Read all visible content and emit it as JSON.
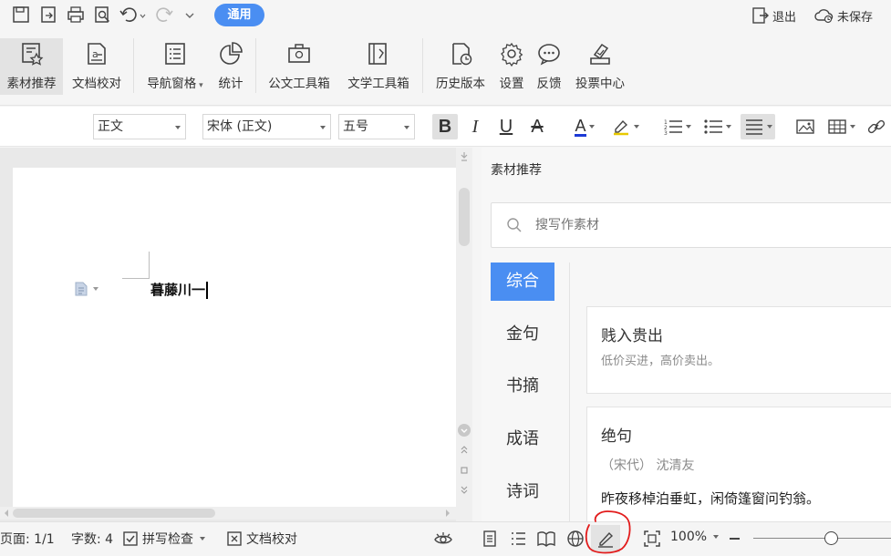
{
  "titlebar": {
    "tab_label": "通用",
    "exit_label": "退出",
    "unsaved_label": "未保存"
  },
  "ribbon": {
    "items": [
      {
        "label": "素材推荐",
        "icon": "material-icon"
      },
      {
        "label": "文档校对",
        "icon": "proofread-icon"
      },
      {
        "label": "导航窗格",
        "icon": "nav-pane-icon"
      },
      {
        "label": "统计",
        "icon": "pie-chart-icon"
      },
      {
        "label": "公文工具箱",
        "icon": "official-toolbox-icon"
      },
      {
        "label": "文学工具箱",
        "icon": "literature-toolbox-icon"
      },
      {
        "label": "历史版本",
        "icon": "history-icon"
      },
      {
        "label": "设置",
        "icon": "gear-icon"
      },
      {
        "label": "反馈",
        "icon": "feedback-icon"
      },
      {
        "label": "投票中心",
        "icon": "vote-icon"
      }
    ]
  },
  "format": {
    "style": "正文",
    "font": "宋体 (正文)",
    "size": "五号",
    "bold": "B",
    "italic": "I",
    "underline": "U",
    "strike": "A",
    "font_color": "A"
  },
  "document": {
    "text": "暮藤川一"
  },
  "pane": {
    "title": "素材推荐",
    "search_placeholder": "搜写作素材",
    "categories": [
      "综合",
      "金句",
      "书摘",
      "成语",
      "诗词"
    ],
    "cards": [
      {
        "title": "贱入贵出",
        "desc": "低价买进，高价卖出。"
      },
      {
        "title": "绝句",
        "meta": "（宋代） 沈清友",
        "line": "昨夜移棹泊垂虹，闲倚篷窗问钓翁。"
      }
    ]
  },
  "status": {
    "page": "页面: 1/1",
    "words": "字数: 4",
    "spellcheck": "拼写检查",
    "proof": "文档校对",
    "zoom": "100%"
  },
  "colors": {
    "accent": "#4a8ef2",
    "annotation": "#e21b1b"
  }
}
